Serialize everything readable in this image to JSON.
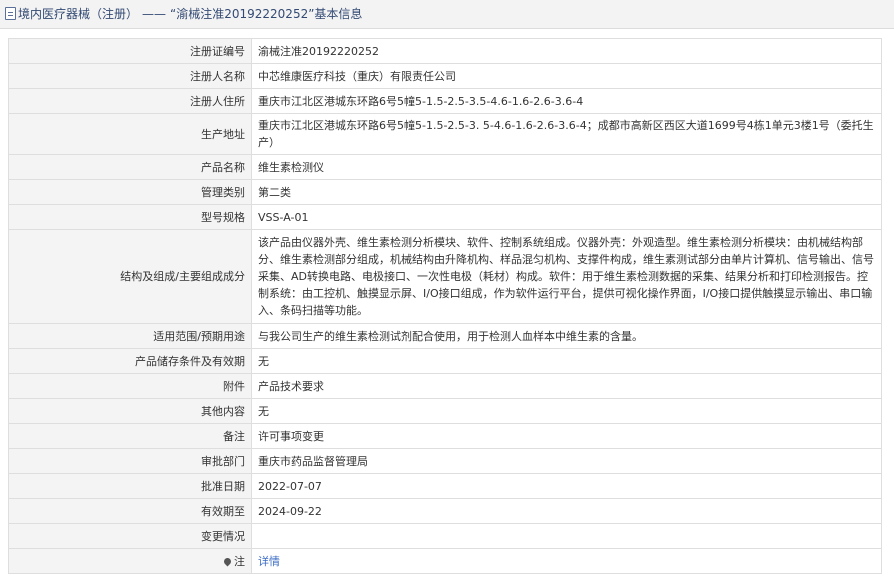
{
  "header": {
    "title_prefix": "境内医疗器械（注册）",
    "title_sep": "——",
    "title_main": "“渝械注准20192220252”基本信息"
  },
  "rows": [
    {
      "label": "注册证编号",
      "value": "渝械注准20192220252"
    },
    {
      "label": "注册人名称",
      "value": "中芯维康医疗科技（重庆）有限责任公司"
    },
    {
      "label": "注册人住所",
      "value": "重庆市江北区港城东环路6号5幢5-1.5-2.5-3.5-4.6-1.6-2.6-3.6-4"
    },
    {
      "label": "生产地址",
      "value": "重庆市江北区港城东环路6号5幢5-1.5-2.5-3. 5-4.6-1.6-2.6-3.6-4；成都市高新区西区大道1699号4栋1单元3楼1号（委托生产）"
    },
    {
      "label": "产品名称",
      "value": "维生素检测仪"
    },
    {
      "label": "管理类别",
      "value": "第二类"
    },
    {
      "label": "型号规格",
      "value": "VSS-A-01"
    },
    {
      "label": "结构及组成/主要组成成分",
      "value": "该产品由仪器外壳、维生素检测分析模块、软件、控制系统组成。仪器外壳：外观造型。维生素检测分析模块：由机械结构部分、维生素检测部分组成，机械结构由升降机构、样品混匀机构、支撑件构成，维生素测试部分由单片计算机、信号输出、信号采集、AD转换电路、电极接口、一次性电极（耗材）构成。软件：用于维生素检测数据的采集、结果分析和打印检测报告。控制系统：由工控机、触摸显示屏、I/O接口组成，作为软件运行平台，提供可视化操作界面，I/O接口提供触摸显示输出、串口输入、条码扫描等功能。"
    },
    {
      "label": "适用范围/预期用途",
      "value": "与我公司生产的维生素检测试剂配合使用，用于检测人血样本中维生素的含量。"
    },
    {
      "label": "产品储存条件及有效期",
      "value": "无"
    },
    {
      "label": "附件",
      "value": "产品技术要求"
    },
    {
      "label": "其他内容",
      "value": "无"
    },
    {
      "label": "备注",
      "value": "许可事项变更"
    },
    {
      "label": "审批部门",
      "value": "重庆市药品监督管理局"
    },
    {
      "label": "批准日期",
      "value": "2022-07-07"
    },
    {
      "label": "有效期至",
      "value": "2024-09-22"
    },
    {
      "label": "变更情况",
      "value": ""
    }
  ],
  "note_row": {
    "label": "注",
    "icon": "pin-icon",
    "link_text": "详情"
  },
  "colors": {
    "title_text": "#334a74",
    "label_bg": "#f4f4f4",
    "border": "#dedede",
    "link": "#3b6cc4"
  }
}
